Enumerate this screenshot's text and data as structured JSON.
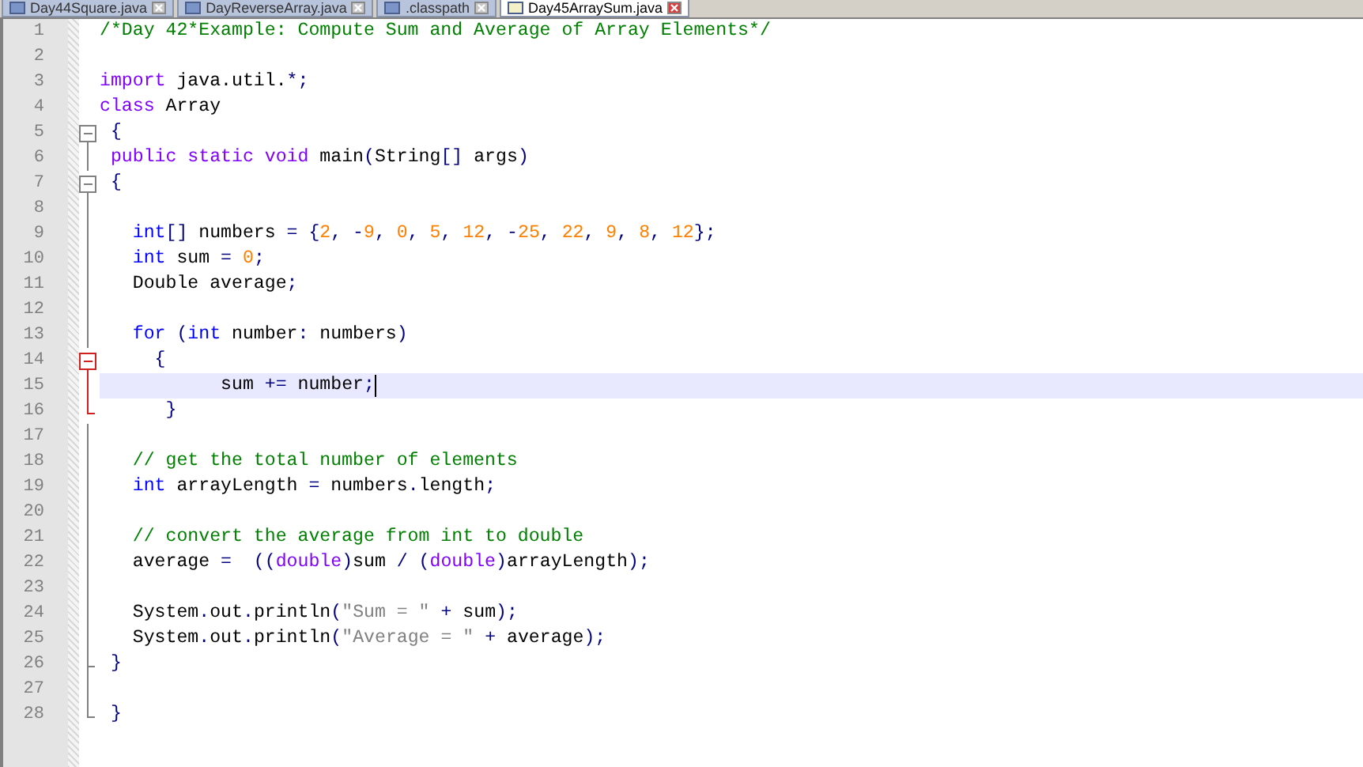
{
  "tabs": [
    {
      "label": "Day44Square.java",
      "selected": false
    },
    {
      "label": "DayReverseArray.java",
      "selected": false
    },
    {
      "label": ".classpath",
      "selected": false
    },
    {
      "label": "Day45ArraySum.java",
      "selected": true
    }
  ],
  "editor": {
    "lines": [
      {
        "number": "1",
        "kind": "none",
        "tokens": [
          {
            "kind": "comment",
            "text": "/*Day 42*Example: Compute Sum and Average of Array Elements*/"
          }
        ]
      },
      {
        "number": "2",
        "kind": "none"
      },
      {
        "number": "3",
        "kind": "none",
        "tokens": [
          {
            "kind": "keyword",
            "text": "import"
          },
          {
            "kind": "plain",
            "text": " java.util."
          },
          {
            "kind": "op",
            "text": "*;"
          }
        ]
      },
      {
        "number": "4",
        "kind": "none",
        "tokens": [
          {
            "kind": "keyword",
            "text": "class"
          },
          {
            "kind": "plain",
            "text": " Array"
          }
        ]
      },
      {
        "number": "5",
        "kind": "open",
        "tokens": [
          {
            "kind": "op",
            "text": " {"
          }
        ]
      },
      {
        "number": "6",
        "kind": "line",
        "tokens": [
          {
            "kind": "keyword",
            "text": " public static void"
          },
          {
            "kind": "plain",
            "text": " main"
          },
          {
            "kind": "op",
            "text": "("
          },
          {
            "kind": "plain",
            "text": "String"
          },
          {
            "kind": "op",
            "text": "[]"
          },
          {
            "kind": "plain",
            "text": " args"
          },
          {
            "kind": "op",
            "text": ")"
          }
        ]
      },
      {
        "number": "7",
        "kind": "open",
        "tokens": [
          {
            "kind": "op",
            "text": " {"
          }
        ]
      },
      {
        "number": "8",
        "kind": "line"
      },
      {
        "number": "9",
        "kind": "line",
        "tokens": [
          {
            "kind": "type",
            "text": "   int"
          },
          {
            "kind": "op",
            "text": "[]"
          },
          {
            "kind": "plain",
            "text": " numbers "
          },
          {
            "kind": "op",
            "text": "= {"
          },
          {
            "kind": "number",
            "text": "2"
          },
          {
            "kind": "op",
            "text": ", -"
          },
          {
            "kind": "number",
            "text": "9"
          },
          {
            "kind": "op",
            "text": ", "
          },
          {
            "kind": "number",
            "text": "0"
          },
          {
            "kind": "op",
            "text": ", "
          },
          {
            "kind": "number",
            "text": "5"
          },
          {
            "kind": "op",
            "text": ", "
          },
          {
            "kind": "number",
            "text": "12"
          },
          {
            "kind": "op",
            "text": ", -"
          },
          {
            "kind": "number",
            "text": "25"
          },
          {
            "kind": "op",
            "text": ", "
          },
          {
            "kind": "number",
            "text": "22"
          },
          {
            "kind": "op",
            "text": ", "
          },
          {
            "kind": "number",
            "text": "9"
          },
          {
            "kind": "op",
            "text": ", "
          },
          {
            "kind": "number",
            "text": "8"
          },
          {
            "kind": "op",
            "text": ", "
          },
          {
            "kind": "number",
            "text": "12"
          },
          {
            "kind": "op",
            "text": "};"
          }
        ]
      },
      {
        "number": "10",
        "kind": "line",
        "tokens": [
          {
            "kind": "type",
            "text": "   int"
          },
          {
            "kind": "plain",
            "text": " sum "
          },
          {
            "kind": "op",
            "text": "= "
          },
          {
            "kind": "number",
            "text": "0"
          },
          {
            "kind": "op",
            "text": ";"
          }
        ]
      },
      {
        "number": "11",
        "kind": "line",
        "tokens": [
          {
            "kind": "plain",
            "text": "   Double average"
          },
          {
            "kind": "op",
            "text": ";"
          }
        ]
      },
      {
        "number": "12",
        "kind": "line"
      },
      {
        "number": "13",
        "kind": "line",
        "tokens": [
          {
            "kind": "type",
            "text": "   for"
          },
          {
            "kind": "op",
            "text": " ("
          },
          {
            "kind": "type",
            "text": "int"
          },
          {
            "kind": "plain",
            "text": " number"
          },
          {
            "kind": "op",
            "text": ":"
          },
          {
            "kind": "plain",
            "text": " numbers"
          },
          {
            "kind": "op",
            "text": ")"
          }
        ]
      },
      {
        "number": "14",
        "kind": "open",
        "active": true,
        "tokens": [
          {
            "kind": "op",
            "text": "     {"
          }
        ]
      },
      {
        "number": "15",
        "kind": "line",
        "active": true,
        "current": true,
        "tokens": [
          {
            "kind": "plain",
            "text": "           sum "
          },
          {
            "kind": "op",
            "text": "+="
          },
          {
            "kind": "plain",
            "text": " number"
          },
          {
            "kind": "op",
            "text": ";"
          }
        ]
      },
      {
        "number": "16",
        "kind": "end",
        "active": true,
        "tokens": [
          {
            "kind": "op",
            "text": "      }"
          }
        ]
      },
      {
        "number": "17",
        "kind": "line"
      },
      {
        "number": "18",
        "kind": "line",
        "tokens": [
          {
            "kind": "comment",
            "text": "   // get the total number of elements"
          }
        ]
      },
      {
        "number": "19",
        "kind": "line",
        "tokens": [
          {
            "kind": "type",
            "text": "   int"
          },
          {
            "kind": "plain",
            "text": " arrayLength "
          },
          {
            "kind": "op",
            "text": "="
          },
          {
            "kind": "plain",
            "text": " numbers"
          },
          {
            "kind": "op",
            "text": "."
          },
          {
            "kind": "plain",
            "text": "length"
          },
          {
            "kind": "op",
            "text": ";"
          }
        ]
      },
      {
        "number": "20",
        "kind": "line"
      },
      {
        "number": "21",
        "kind": "line",
        "tokens": [
          {
            "kind": "comment",
            "text": "   // convert the average from int to double"
          }
        ]
      },
      {
        "number": "22",
        "kind": "line",
        "tokens": [
          {
            "kind": "plain",
            "text": "   average "
          },
          {
            "kind": "op",
            "text": "=  (("
          },
          {
            "kind": "keyword",
            "text": "double"
          },
          {
            "kind": "op",
            "text": ")"
          },
          {
            "kind": "plain",
            "text": "sum "
          },
          {
            "kind": "op",
            "text": "/ ("
          },
          {
            "kind": "keyword",
            "text": "double"
          },
          {
            "kind": "op",
            "text": ")"
          },
          {
            "kind": "plain",
            "text": "arrayLength"
          },
          {
            "kind": "op",
            "text": ");"
          }
        ]
      },
      {
        "number": "23",
        "kind": "line"
      },
      {
        "number": "24",
        "kind": "line",
        "tokens": [
          {
            "kind": "plain",
            "text": "   System"
          },
          {
            "kind": "op",
            "text": "."
          },
          {
            "kind": "plain",
            "text": "out"
          },
          {
            "kind": "op",
            "text": "."
          },
          {
            "kind": "plain",
            "text": "println"
          },
          {
            "kind": "op",
            "text": "("
          },
          {
            "kind": "string",
            "text": "\"Sum = \""
          },
          {
            "kind": "op",
            "text": " +"
          },
          {
            "kind": "plain",
            "text": " sum"
          },
          {
            "kind": "op",
            "text": ");"
          }
        ]
      },
      {
        "number": "25",
        "kind": "line",
        "tokens": [
          {
            "kind": "plain",
            "text": "   System"
          },
          {
            "kind": "op",
            "text": "."
          },
          {
            "kind": "plain",
            "text": "out"
          },
          {
            "kind": "op",
            "text": "."
          },
          {
            "kind": "plain",
            "text": "println"
          },
          {
            "kind": "op",
            "text": "("
          },
          {
            "kind": "string",
            "text": "\"Average = \""
          },
          {
            "kind": "op",
            "text": " +"
          },
          {
            "kind": "plain",
            "text": " average"
          },
          {
            "kind": "op",
            "text": ");"
          }
        ]
      },
      {
        "number": "26",
        "kind": "tee",
        "tokens": [
          {
            "kind": "op",
            "text": " }"
          }
        ]
      },
      {
        "number": "27",
        "kind": "line"
      },
      {
        "number": "28",
        "kind": "end",
        "tokens": [
          {
            "kind": "op",
            "text": " }"
          }
        ]
      }
    ]
  }
}
